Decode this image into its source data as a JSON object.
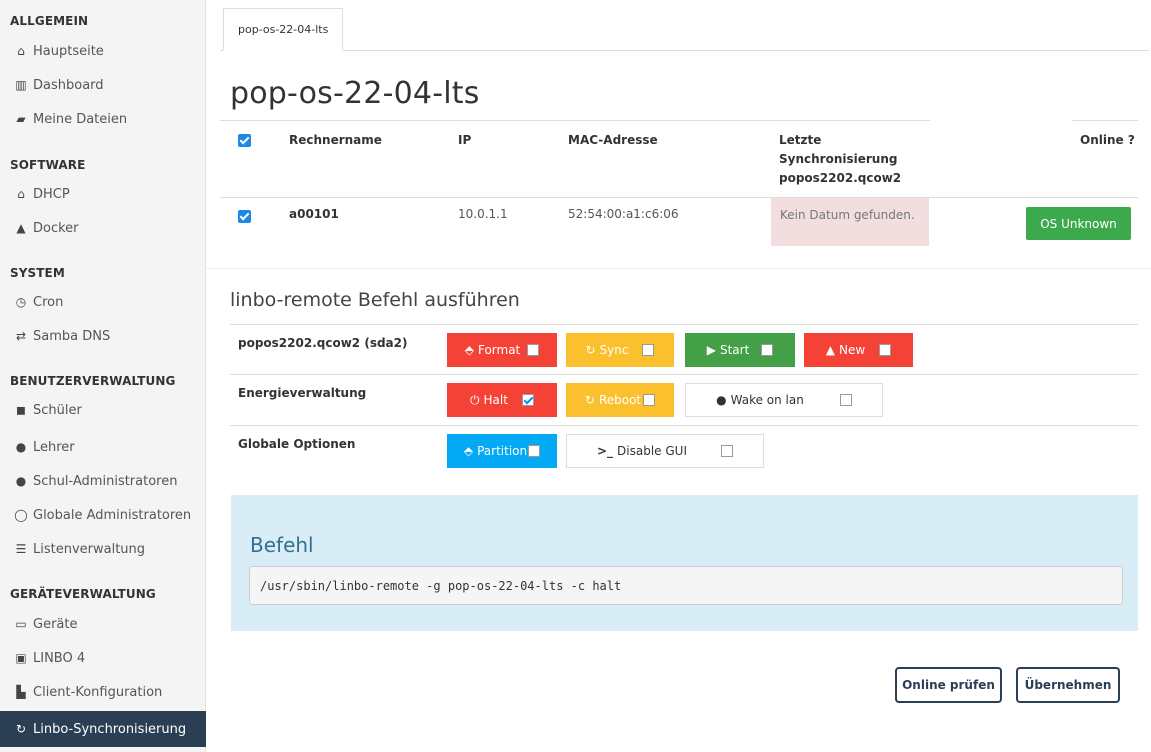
{
  "sidebar": {
    "sections": [
      {
        "title": "ALLGEMEIN",
        "items": [
          {
            "label": "Hauptseite",
            "icon": "home-icon",
            "glyph": "⌂"
          },
          {
            "label": "Dashboard",
            "icon": "bar-chart-icon",
            "glyph": "▥"
          },
          {
            "label": "Meine Dateien",
            "icon": "folder-icon",
            "glyph": "▰"
          }
        ]
      },
      {
        "title": "SOFTWARE",
        "items": [
          {
            "label": "DHCP",
            "icon": "institution-icon",
            "glyph": "⌂"
          },
          {
            "label": "Docker",
            "icon": "docker-icon",
            "glyph": "▲"
          }
        ]
      },
      {
        "title": "SYSTEM",
        "items": [
          {
            "label": "Cron",
            "icon": "clock-icon",
            "glyph": "◷"
          },
          {
            "label": "Samba DNS",
            "icon": "exchange-icon",
            "glyph": "⇄"
          }
        ]
      },
      {
        "title": "BENUTZERVERWALTUNG",
        "items": [
          {
            "label": "Schüler",
            "icon": "student-icon",
            "glyph": "◼"
          },
          {
            "label": "Lehrer",
            "icon": "teacher-icon",
            "glyph": "●"
          },
          {
            "label": "Schul-Administratoren",
            "icon": "school-admin-icon",
            "glyph": "●"
          },
          {
            "label": "Globale Administratoren",
            "icon": "global-admin-icon",
            "glyph": "◯"
          },
          {
            "label": "Listenverwaltung",
            "icon": "list-icon",
            "glyph": "☰"
          }
        ]
      },
      {
        "title": "GERÄTEVERWALTUNG",
        "items": [
          {
            "label": "Geräte",
            "icon": "laptop-icon",
            "glyph": "▭"
          },
          {
            "label": "LINBO 4",
            "icon": "linbo-icon",
            "glyph": "▣"
          },
          {
            "label": "Client-Konfiguration",
            "icon": "sitemap-icon",
            "glyph": "▙"
          },
          {
            "label": "Linbo-Synchronisierung",
            "icon": "refresh-icon",
            "glyph": "↻",
            "active": true
          }
        ]
      }
    ]
  },
  "tab": {
    "label": "pop-os-22-04-lts"
  },
  "page_title": "pop-os-22-04-lts",
  "table": {
    "headers": {
      "name": "Rechnername",
      "ip": "IP",
      "mac": "MAC-Adresse",
      "sync_line1": "Letzte",
      "sync_line2": "Synchronisierung",
      "sync_line3": "popos2202.qcow2",
      "online": "Online ?"
    },
    "row": {
      "name": "a00101",
      "ip": "10.0.1.1",
      "mac": "52:54:00:a1:c6:06",
      "sync": "Kein Datum gefunden.",
      "online_btn": "OS Unknown"
    }
  },
  "remote": {
    "heading": "linbo-remote Befehl ausführen",
    "rows": {
      "image_label": "popos2202.qcow2 (sda2)",
      "energy_label": "Energieverwaltung",
      "global_label": "Globale Optionen"
    },
    "buttons": {
      "format": "Format",
      "sync": "Sync",
      "start": "Start",
      "new": "New",
      "halt": "Halt",
      "reboot": "Reboot",
      "wol": "Wake on lan",
      "partition": "Partition",
      "disable_gui": "Disable GUI"
    }
  },
  "command": {
    "heading": "Befehl",
    "text": "/usr/sbin/linbo-remote -g pop-os-22-04-lts -c halt"
  },
  "actions": {
    "check_online": "Online prüfen",
    "apply": "Übernehmen"
  },
  "colors": {
    "sidebar_active": "#2a3f54",
    "red": "#f44336",
    "yellow": "#fbc02d",
    "green": "#43a047",
    "blue": "#03a9f4",
    "online_green": "#3caa4c"
  }
}
